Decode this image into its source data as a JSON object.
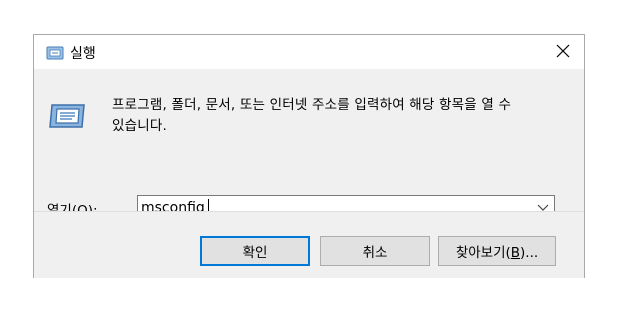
{
  "window": {
    "title": "실행",
    "close_glyph": "✕"
  },
  "description": {
    "line1": "프로그램, 폴더, 문서, 또는 인터넷 주소를 입력하여 해당 항목을 열 수",
    "line2": "있습니다."
  },
  "open_field": {
    "label_prefix": "열기(",
    "label_accesskey": "O",
    "label_suffix": "):",
    "value": "msconfig"
  },
  "buttons": {
    "ok": "확인",
    "cancel": "취소",
    "browse_prefix": "찾아보기(",
    "browse_accesskey": "B",
    "browse_suffix": ")..."
  },
  "colors": {
    "accent": "#0078d7",
    "dialog_bg": "#f0f0f0",
    "icon_blue": "#5b8fc7"
  },
  "icons": {
    "title": "run-icon",
    "main": "run-icon",
    "close": "close-icon",
    "dropdown": "chevron-down-icon"
  }
}
